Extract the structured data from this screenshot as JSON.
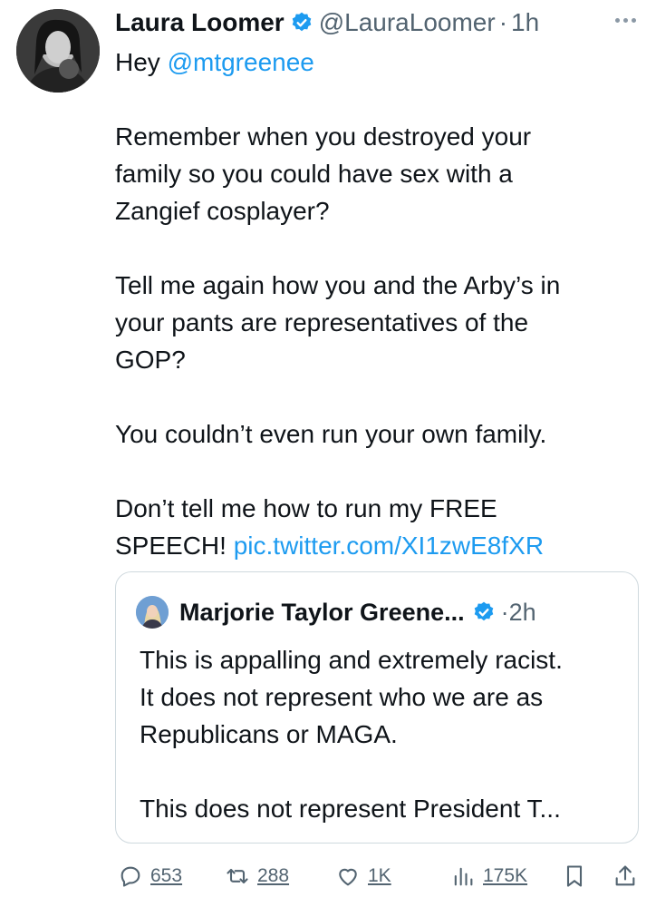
{
  "tweet": {
    "author": "Laura Loomer",
    "handle": "@LauraLoomer",
    "separator": "·",
    "time": "1h",
    "lines": [
      "Hey @mtgreenee",
      "",
      "Remember when you destroyed your",
      "family so you could have sex with a",
      "Zangief cosplayer?",
      "",
      "Tell me again how you and the Arby’s in",
      "your pants are representatives of the",
      "GOP?",
      "",
      "You couldn’t even run your own family.",
      "",
      "Don’t tell me how to run my FREE"
    ],
    "mention": "@mtgreenee",
    "hey": "Hey",
    "last_line_text": "SPEECH!",
    "link": "pic.twitter.com/XI1zwE8fXR"
  },
  "quote": {
    "author": "Marjorie Taylor Greene...",
    "separator": "·",
    "time": "2h",
    "lines": [
      "This is appalling and extremely racist.",
      "It does not represent who we are as",
      "Republicans or MAGA.",
      "",
      "This does not represent President T..."
    ]
  },
  "actions": {
    "replies": "653",
    "retweets": "288",
    "likes": "1K",
    "views": "175K"
  },
  "colors": {
    "link": "#1d9bf0",
    "verified": "#1d9bf0",
    "muted": "#536471"
  }
}
